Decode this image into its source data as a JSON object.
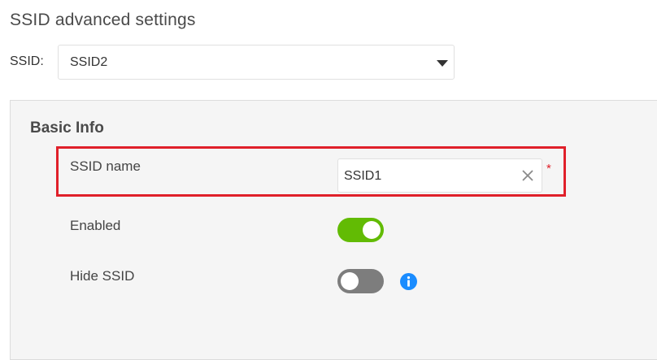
{
  "header": {
    "title": "SSID advanced settings"
  },
  "ssid_selector": {
    "label": "SSID:",
    "selected": "SSID2",
    "caret_icon": "caret-down-icon"
  },
  "basic_info": {
    "title": "Basic Info",
    "ssid_name": {
      "label": "SSID name",
      "value": "SSID1",
      "clear_icon": "clear-x-icon",
      "required_mark": "*"
    },
    "enabled": {
      "label": "Enabled",
      "state": true
    },
    "hide_ssid": {
      "label": "Hide SSID",
      "state": false,
      "info_icon": "info-icon"
    }
  },
  "colors": {
    "highlight": "#e0202a",
    "toggle_on": "#62bb04",
    "toggle_off": "#7d7d7d",
    "info": "#1a8cff",
    "panel_bg": "#f5f5f5"
  }
}
